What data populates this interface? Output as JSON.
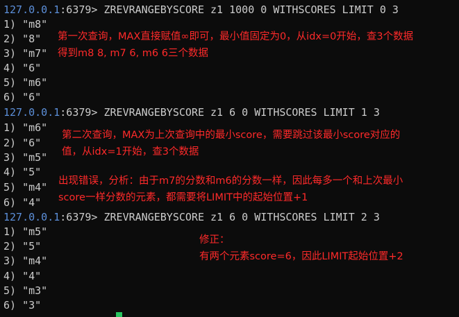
{
  "session": {
    "host": "127.0.0.1",
    "port_suffix": ":6379> "
  },
  "blocks": [
    {
      "command": "ZREVRANGEBYSCORE z1 1000 0 WITHSCORES LIMIT 0 3",
      "results": [
        "1) \"m8\"",
        "2) \"8\"",
        "3) \"m7\"",
        "4) \"6\"",
        "5) \"m6\"",
        "6) \"6\""
      ]
    },
    {
      "command": "ZREVRANGEBYSCORE z1 6 0 WITHSCORES LIMIT 1 3",
      "results": [
        "1) \"m6\"",
        "2) \"6\"",
        "3) \"m5\"",
        "4) \"5\"",
        "5) \"m4\"",
        "6) \"4\""
      ]
    },
    {
      "command": "ZREVRANGEBYSCORE z1 6 0 WITHSCORES LIMIT 2 3",
      "results": [
        "1) \"m5\"",
        "2) \"5\"",
        "3) \"m4\"",
        "4) \"4\"",
        "5) \"m3\"",
        "6) \"3\""
      ]
    }
  ],
  "annotations": {
    "note1": {
      "line1": "第一次查询，MAX直接赋值∞即可，最小值固定为0，从idx=0开始，查3个数据",
      "line2": "得到m8 8, m7 6, m6 6三个数据"
    },
    "note2": {
      "line1": "第二次查询，MAX为上次查询中的最小score，需要跳过该最小score对应的",
      "line2": "值，从idx=1开始，查3个数据"
    },
    "note3": {
      "line1": "出现错误，分析：由于m7的分数和m6的分数一样，因此每多一个和上次最小",
      "line2": "score一样分数的元素，都需要将LIMIT中的起始位置+1"
    },
    "note4": {
      "line1": "修正：",
      "line2": "有两个元素score=6，因此LIMIT起始位置+2"
    }
  },
  "colors": {
    "background": "#0c0c0c",
    "text": "#cccccc",
    "host": "#5c8fd9",
    "annotation": "#ff2a2a",
    "cursor": "#27c45f"
  }
}
